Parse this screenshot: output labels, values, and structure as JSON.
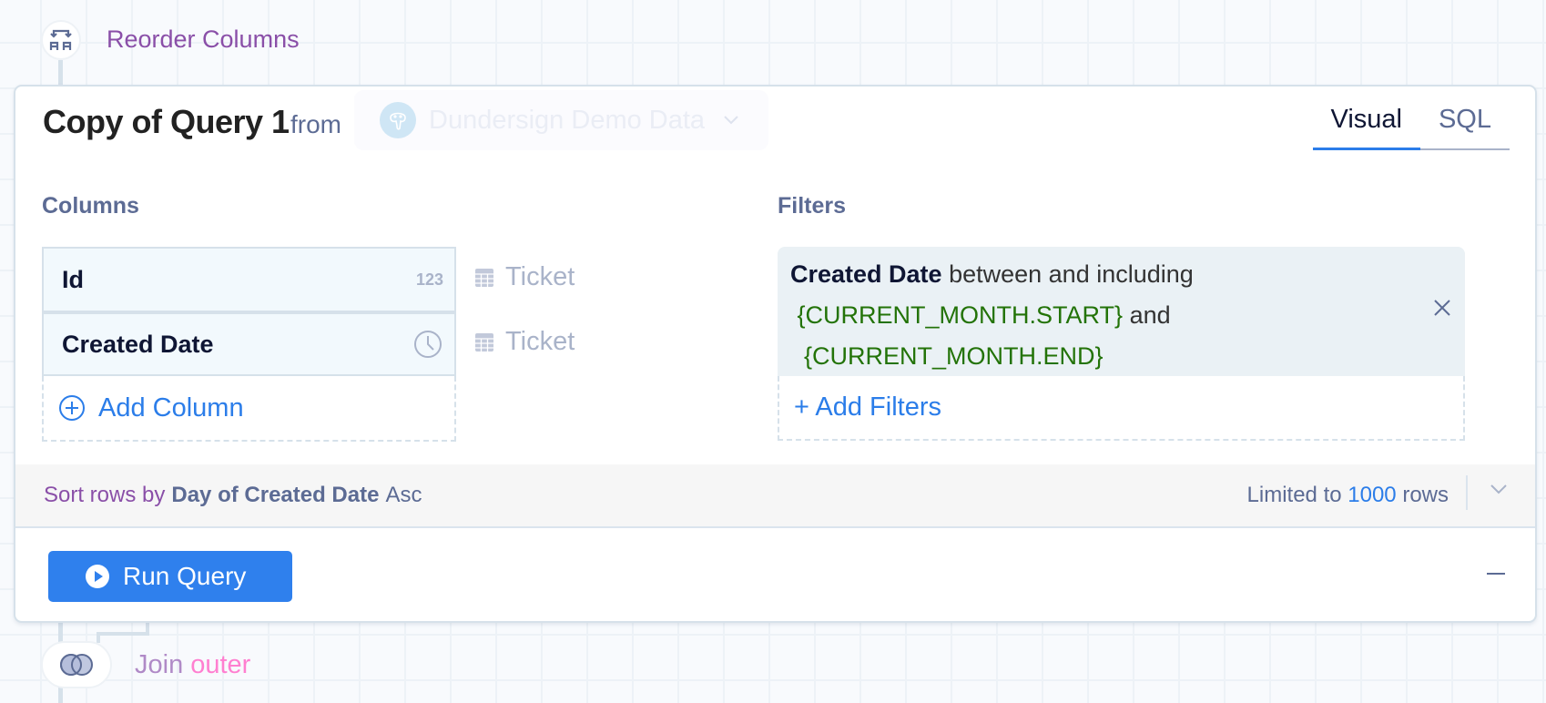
{
  "steps": {
    "reorder": {
      "label": "Reorder Columns",
      "icon": "reorder-columns-icon"
    },
    "join": {
      "label": "Join",
      "type": "outer",
      "icon": "venn-join-icon"
    }
  },
  "query": {
    "title": "Copy of Query 1",
    "from_label": "from",
    "datasource": {
      "name": "Dundersign Demo Data",
      "icon": "postgres-elephant-icon"
    },
    "tabs": [
      {
        "label": "Visual",
        "active": true
      },
      {
        "label": "SQL",
        "active": false
      }
    ]
  },
  "columns": {
    "label": "Columns",
    "items": [
      {
        "name": "Id",
        "type_badge": "123",
        "type_icon": "number-icon",
        "source": "Ticket"
      },
      {
        "name": "Created Date",
        "type_badge": "",
        "type_icon": "clock-icon",
        "source": "Ticket"
      }
    ],
    "add_label": "Add Column"
  },
  "filters": {
    "label": "Filters",
    "items": [
      {
        "field": "Created Date",
        "operator": "between and including",
        "value_start": "{CURRENT_MONTH.START}",
        "joiner": "and",
        "value_end": "{CURRENT_MONTH.END}"
      }
    ],
    "add_label": "+ Add Filters"
  },
  "sort": {
    "label": "Sort rows by",
    "field": "Day of Created Date",
    "direction": "Asc"
  },
  "limit": {
    "prefix": "Limited to",
    "value": "1000",
    "suffix": "rows"
  },
  "actions": {
    "run_label": "Run Query"
  },
  "colors": {
    "accent": "#2f80ed",
    "step_label": "#8a4fa8",
    "filter_value": "#237308",
    "join_type": "#ff7fd0"
  }
}
